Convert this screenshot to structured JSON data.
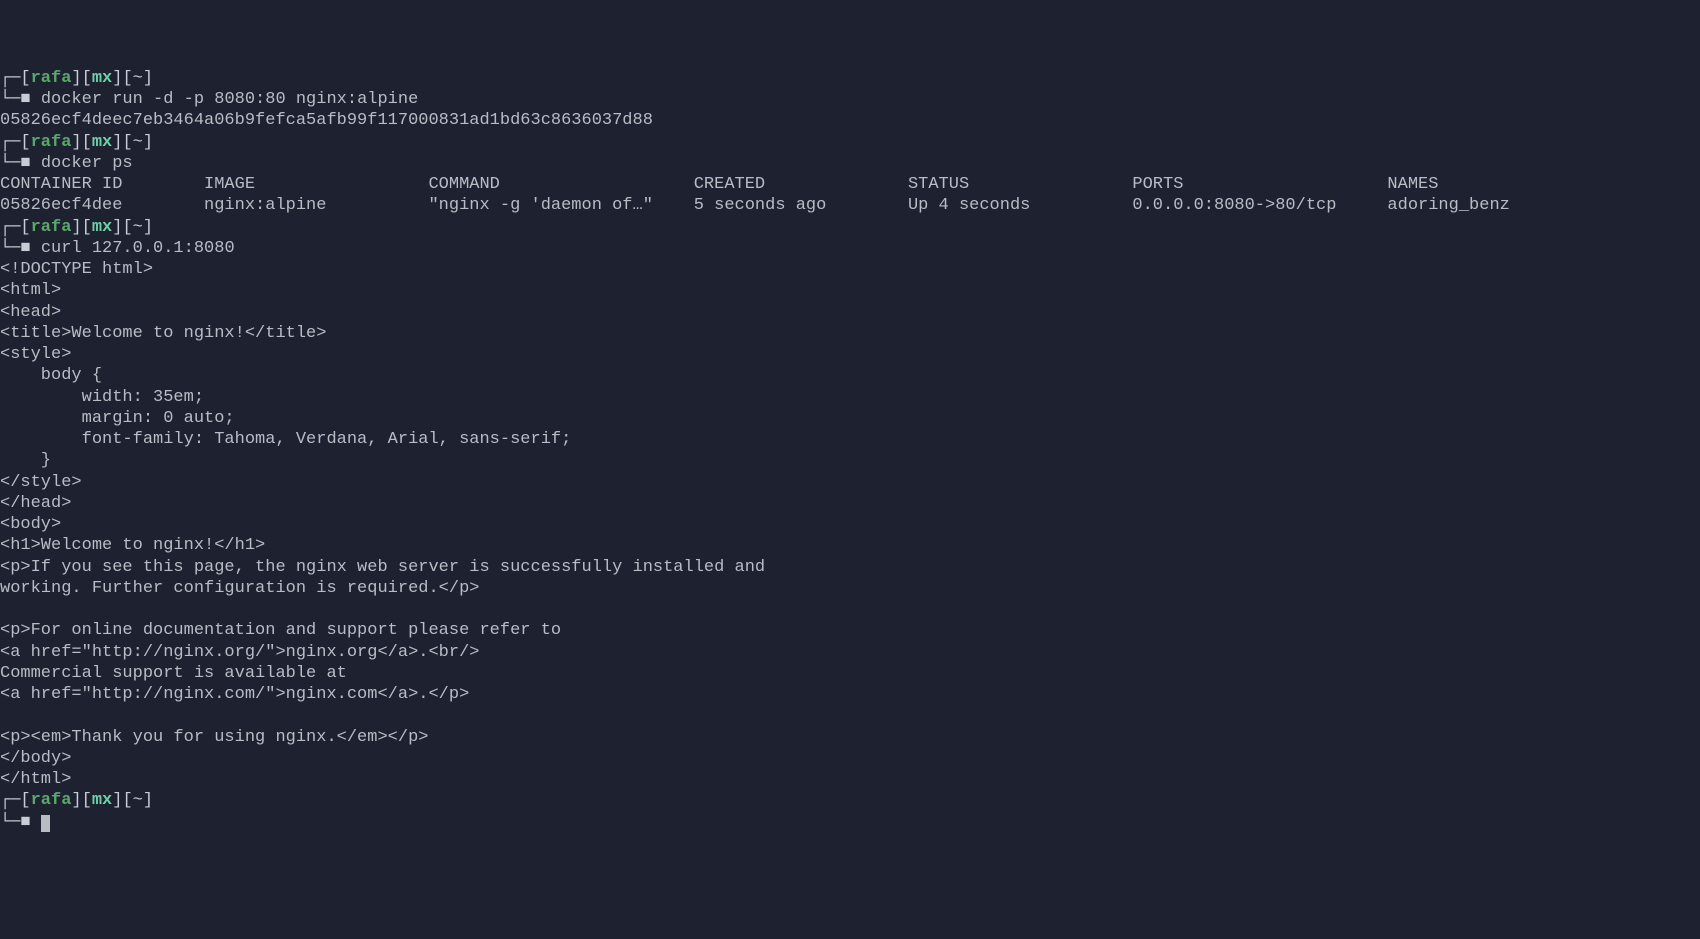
{
  "prompt": {
    "corner_top": "┌─",
    "corner_bottom": "└─",
    "lb": "[",
    "rb": "]",
    "user": "rafa",
    "host": "mx",
    "path": "~",
    "arrow": "■ "
  },
  "block1": {
    "command": "docker run -d -p 8080:80 nginx:alpine",
    "output": "05826ecf4deec7eb3464a06b9fefca5afb99f117000831ad1bd63c8636037d88"
  },
  "block2": {
    "command": "docker ps",
    "header": {
      "c1": "CONTAINER ID",
      "c2": "IMAGE",
      "c3": "COMMAND",
      "c4": "CREATED",
      "c5": "STATUS",
      "c6": "PORTS",
      "c7": "NAMES"
    },
    "row": {
      "c1": "05826ecf4dee",
      "c2": "nginx:alpine",
      "c3": "\"nginx -g 'daemon of…\"",
      "c4": "5 seconds ago",
      "c5": "Up 4 seconds",
      "c6": "0.0.0.0:8080->80/tcp",
      "c7": "adoring_benz"
    }
  },
  "block3": {
    "command": "curl 127.0.0.1:8080",
    "lines": [
      "<!DOCTYPE html>",
      "<html>",
      "<head>",
      "<title>Welcome to nginx!</title>",
      "<style>",
      "    body {",
      "        width: 35em;",
      "        margin: 0 auto;",
      "        font-family: Tahoma, Verdana, Arial, sans-serif;",
      "    }",
      "</style>",
      "</head>",
      "<body>",
      "<h1>Welcome to nginx!</h1>",
      "<p>If you see this page, the nginx web server is successfully installed and",
      "working. Further configuration is required.</p>",
      "",
      "<p>For online documentation and support please refer to",
      "<a href=\"http://nginx.org/\">nginx.org</a>.<br/>",
      "Commercial support is available at",
      "<a href=\"http://nginx.com/\">nginx.com</a>.</p>",
      "",
      "<p><em>Thank you for using nginx.</em></p>",
      "</body>",
      "</html>"
    ]
  }
}
